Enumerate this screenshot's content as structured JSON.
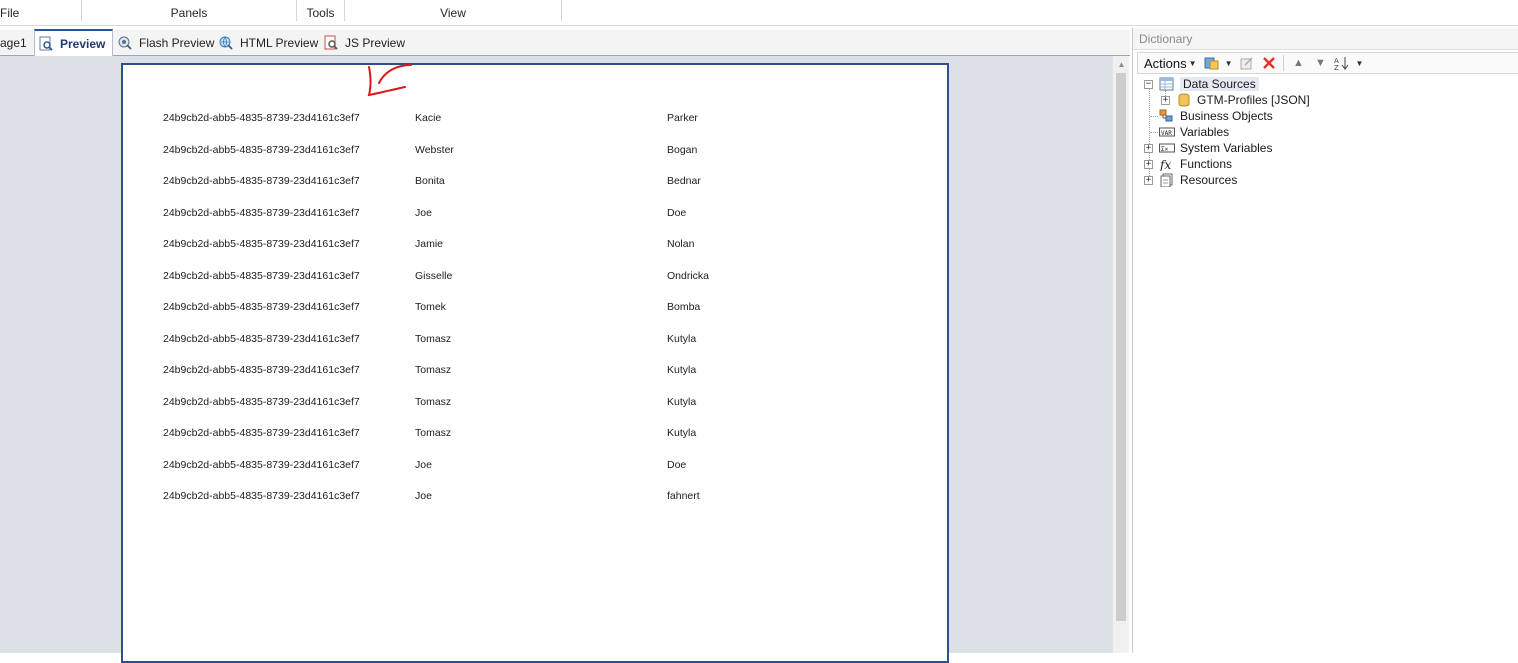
{
  "ribbon": {
    "groups": [
      {
        "label": "File"
      },
      {
        "label": "Panels"
      },
      {
        "label": "Tools"
      },
      {
        "label": "View"
      }
    ]
  },
  "tabs": [
    {
      "label": "age1"
    },
    {
      "label": "Preview"
    },
    {
      "label": "Flash Preview"
    },
    {
      "label": "HTML Preview"
    },
    {
      "label": "JS Preview"
    }
  ],
  "report": {
    "rows": [
      {
        "id": "24b9cb2d-abb5-4835-8739-23d4161c3ef7",
        "first": "Kacie",
        "last": "Parker"
      },
      {
        "id": "24b9cb2d-abb5-4835-8739-23d4161c3ef7",
        "first": "Webster",
        "last": "Bogan"
      },
      {
        "id": "24b9cb2d-abb5-4835-8739-23d4161c3ef7",
        "first": "Bonita",
        "last": "Bednar"
      },
      {
        "id": "24b9cb2d-abb5-4835-8739-23d4161c3ef7",
        "first": "Joe",
        "last": "Doe"
      },
      {
        "id": "24b9cb2d-abb5-4835-8739-23d4161c3ef7",
        "first": "Jamie",
        "last": "Nolan"
      },
      {
        "id": "24b9cb2d-abb5-4835-8739-23d4161c3ef7",
        "first": "Gisselle",
        "last": "Ondricka"
      },
      {
        "id": "24b9cb2d-abb5-4835-8739-23d4161c3ef7",
        "first": "Tomek",
        "last": "Bomba"
      },
      {
        "id": "24b9cb2d-abb5-4835-8739-23d4161c3ef7",
        "first": "Tomasz",
        "last": "Kutyla"
      },
      {
        "id": "24b9cb2d-abb5-4835-8739-23d4161c3ef7",
        "first": "Tomasz",
        "last": "Kutyla"
      },
      {
        "id": "24b9cb2d-abb5-4835-8739-23d4161c3ef7",
        "first": "Tomasz",
        "last": "Kutyla"
      },
      {
        "id": "24b9cb2d-abb5-4835-8739-23d4161c3ef7",
        "first": "Tomasz",
        "last": "Kutyla"
      },
      {
        "id": "24b9cb2d-abb5-4835-8739-23d4161c3ef7",
        "first": "Joe",
        "last": "Doe"
      },
      {
        "id": "24b9cb2d-abb5-4835-8739-23d4161c3ef7",
        "first": "Joe",
        "last": "fahnert"
      }
    ]
  },
  "dictionary": {
    "title": "Dictionary",
    "actions_label": "Actions",
    "tree": {
      "data_sources": "Data Sources",
      "gtm_profiles": "GTM-Profiles [JSON]",
      "business_objects": "Business Objects",
      "variables": "Variables",
      "system_variables": "System Variables",
      "functions": "Functions",
      "resources": "Resources"
    }
  },
  "colors": {
    "accent": "#2b579a",
    "page_border": "#2e4f8a",
    "canvas_bg": "#dce1e8",
    "annotation": "#e0141c"
  }
}
